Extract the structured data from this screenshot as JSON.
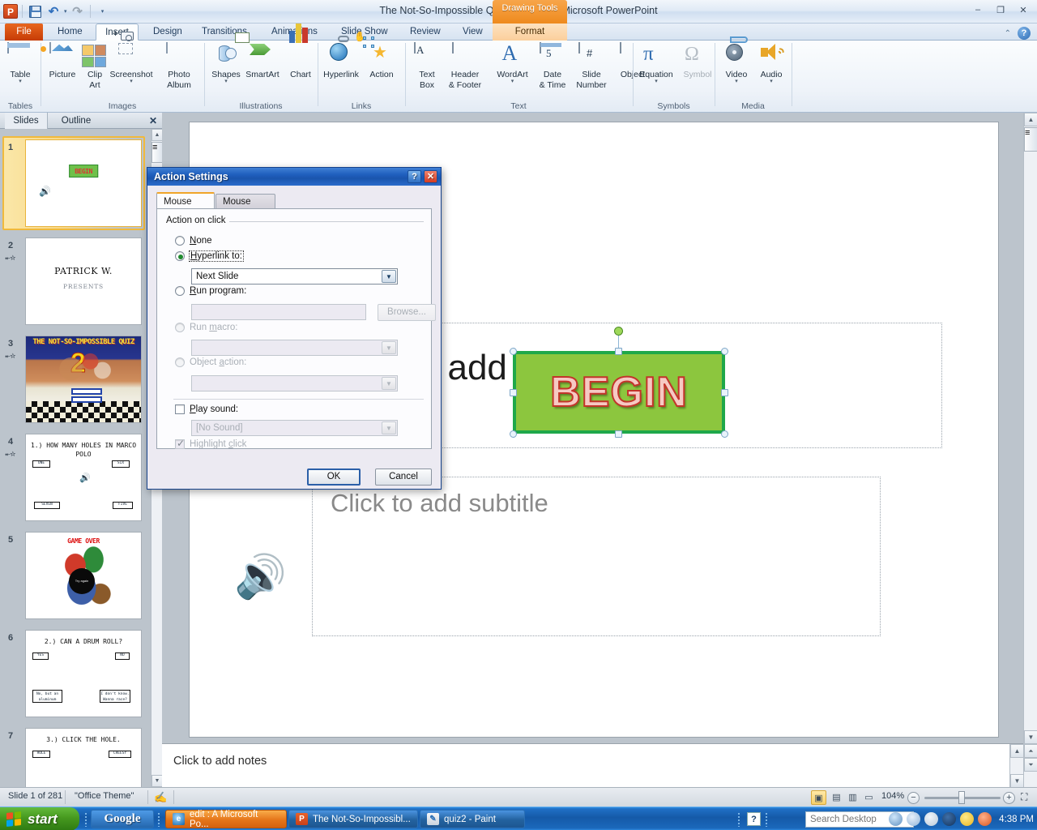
{
  "window": {
    "title": "The Not-So-Impossible Quiz 2 Original  -  Microsoft PowerPoint",
    "minimize": "–",
    "restore": "❐",
    "close": "✕"
  },
  "quick_access": {
    "app_icon": "P",
    "save": "save-icon",
    "undo": "↶",
    "undo_drop": "▾",
    "redo": "↷",
    "customize": "▾"
  },
  "ribbon": {
    "file_tab": "File",
    "tabs": [
      {
        "label": "Home",
        "active": false
      },
      {
        "label": "Insert",
        "active": true
      },
      {
        "label": "Design",
        "active": false
      },
      {
        "label": "Transitions",
        "active": false
      },
      {
        "label": "Animations",
        "active": false
      },
      {
        "label": "Slide Show",
        "active": false
      },
      {
        "label": "Review",
        "active": false
      },
      {
        "label": "View",
        "active": false
      }
    ],
    "contextual": {
      "header": "Drawing Tools",
      "tab": "Format"
    },
    "minimize_ribbon": "⌃",
    "help": "?",
    "groups": [
      {
        "label": "Tables"
      },
      {
        "label": "Images"
      },
      {
        "label": "Illustrations"
      },
      {
        "label": "Links"
      },
      {
        "label": "Text"
      },
      {
        "label": "Symbols"
      },
      {
        "label": "Media"
      }
    ],
    "buttons": {
      "table": "Table",
      "picture": "Picture",
      "clip_art_l1": "Clip",
      "clip_art_l2": "Art",
      "screenshot": "Screenshot",
      "photo_album_l1": "Photo",
      "photo_album_l2": "Album",
      "shapes": "Shapes",
      "smartart": "SmartArt",
      "chart": "Chart",
      "hyperlink": "Hyperlink",
      "action": "Action",
      "text_box_l1": "Text",
      "text_box_l2": "Box",
      "header_footer_l1": "Header",
      "header_footer_l2": "& Footer",
      "wordart": "WordArt",
      "date_time_l1": "Date",
      "date_time_l2": "& Time",
      "slide_number_l1": "Slide",
      "slide_number_l2": "Number",
      "object": "Object",
      "equation": "Equation",
      "symbol": "Symbol",
      "video": "Video",
      "audio": "Audio",
      "dropdown": "▾"
    }
  },
  "slide_pane": {
    "tabs": [
      {
        "label": "Slides",
        "selected": true
      },
      {
        "label": "Outline",
        "selected": false
      }
    ],
    "close": "✕",
    "scroll_up": "▲",
    "scroll_down": "▼",
    "thumbnails": [
      {
        "number": "1",
        "has_badge": false,
        "selected": true,
        "kind": "begin",
        "begin_label": "BEGIN"
      },
      {
        "number": "2",
        "has_badge": true,
        "selected": false,
        "kind": "presents",
        "title": "PATRICK W.",
        "subtitle": "PRESENTS"
      },
      {
        "number": "3",
        "has_badge": true,
        "selected": false,
        "kind": "quiz-cover",
        "banner": "THE NOT-SO-IMPOSSIBLE QUIZ",
        "big_number": "2"
      },
      {
        "number": "4",
        "has_badge": true,
        "selected": false,
        "kind": "question",
        "question": "1.) HOW MANY HOLES IN MARCO POLO",
        "answers": [
          "ONE",
          "SIX",
          "SEVEN",
          "FIVE"
        ]
      },
      {
        "number": "5",
        "has_badge": false,
        "selected": false,
        "kind": "gameover",
        "label": "GAME OVER",
        "bomb_text": "Try again"
      },
      {
        "number": "6",
        "has_badge": false,
        "selected": false,
        "kind": "question",
        "question": "2.) CAN A DRUM ROLL?",
        "answers": [
          "YES",
          "NO",
          "No, but an aluminum can.",
          "I don't know. Wanna race?"
        ]
      },
      {
        "number": "7",
        "has_badge": false,
        "selected": false,
        "kind": "question",
        "question": "3.) CLICK THE HOLE.",
        "answers": [
          "HOLE",
          "CHEESY"
        ]
      }
    ]
  },
  "slide": {
    "title_placeholder": "Click to add title",
    "subtitle_placeholder": "Click to add subtitle",
    "shape_text": "BEGIN",
    "audio_icon": "speaker-icon",
    "shape_fill": "#8cc63e",
    "shape_border": "#1fa84a",
    "shape_text_color": "#f6c9c3",
    "shape_text_outline": "#c3342a"
  },
  "notes": {
    "placeholder": "Click to add notes"
  },
  "status_bar": {
    "slide_count": "Slide 1 of 281",
    "theme": "\"Office Theme\"",
    "spelling_icon": "spell-check-icon",
    "views": [
      {
        "name": "normal-view",
        "glyph": "▣",
        "selected": true
      },
      {
        "name": "slide-sorter-view",
        "glyph": "▤",
        "selected": false
      },
      {
        "name": "reading-view",
        "glyph": "▥",
        "selected": false
      },
      {
        "name": "slide-show-view",
        "glyph": "▭",
        "selected": false
      }
    ],
    "zoom_level": "104%",
    "zoom_out": "−",
    "zoom_in": "+",
    "fit_to_window": "⛶"
  },
  "dialog": {
    "title": "Action Settings",
    "help_button": "?",
    "close_button": "✕",
    "tabs": [
      {
        "label": "Mouse Click",
        "selected": true
      },
      {
        "label": "Mouse Over",
        "selected": false
      }
    ],
    "group_label": "Action on click",
    "options": [
      {
        "label": "None",
        "underline": "N",
        "selected": false,
        "disabled": false
      },
      {
        "label": "Hyperlink to:",
        "underline": "H",
        "selected": true,
        "disabled": false,
        "focused": true
      },
      {
        "label": "Run program:",
        "underline": "R",
        "selected": false,
        "disabled": false
      },
      {
        "label": "Run macro:",
        "underline": "m",
        "selected": false,
        "disabled": true
      },
      {
        "label": "Object action:",
        "underline": "a",
        "selected": false,
        "disabled": true
      }
    ],
    "hyperlink_value": "Next Slide",
    "program_value": "",
    "browse_button": "Browse...",
    "macro_value": "",
    "object_action_value": "",
    "play_sound_label": "Play sound:",
    "play_sound_checked": false,
    "sound_value": "[No Sound]",
    "highlight_click_label": "Highlight click",
    "highlight_click_checked": true,
    "ok_button": "OK",
    "cancel_button": "Cancel",
    "dropdown_glyph": "▼"
  },
  "taskbar": {
    "start": "start",
    "items": [
      {
        "label": "Google",
        "type": "google"
      },
      {
        "label": "edit : A Microsoft Po...",
        "type": "active",
        "icon": "e"
      },
      {
        "label": "The Not-So-Impossibl...",
        "type": "normal",
        "icon": "P"
      },
      {
        "label": "quiz2 - Paint",
        "type": "normal",
        "icon": "✎"
      }
    ],
    "search_placeholder": "Search Desktop",
    "search_value": "",
    "clock": "4:38 PM",
    "tray_icons": [
      "back-icon",
      "search-icon",
      "loading-icon",
      "amazon-icon",
      "smiley-icon",
      "frown-icon"
    ],
    "notification": "?"
  }
}
